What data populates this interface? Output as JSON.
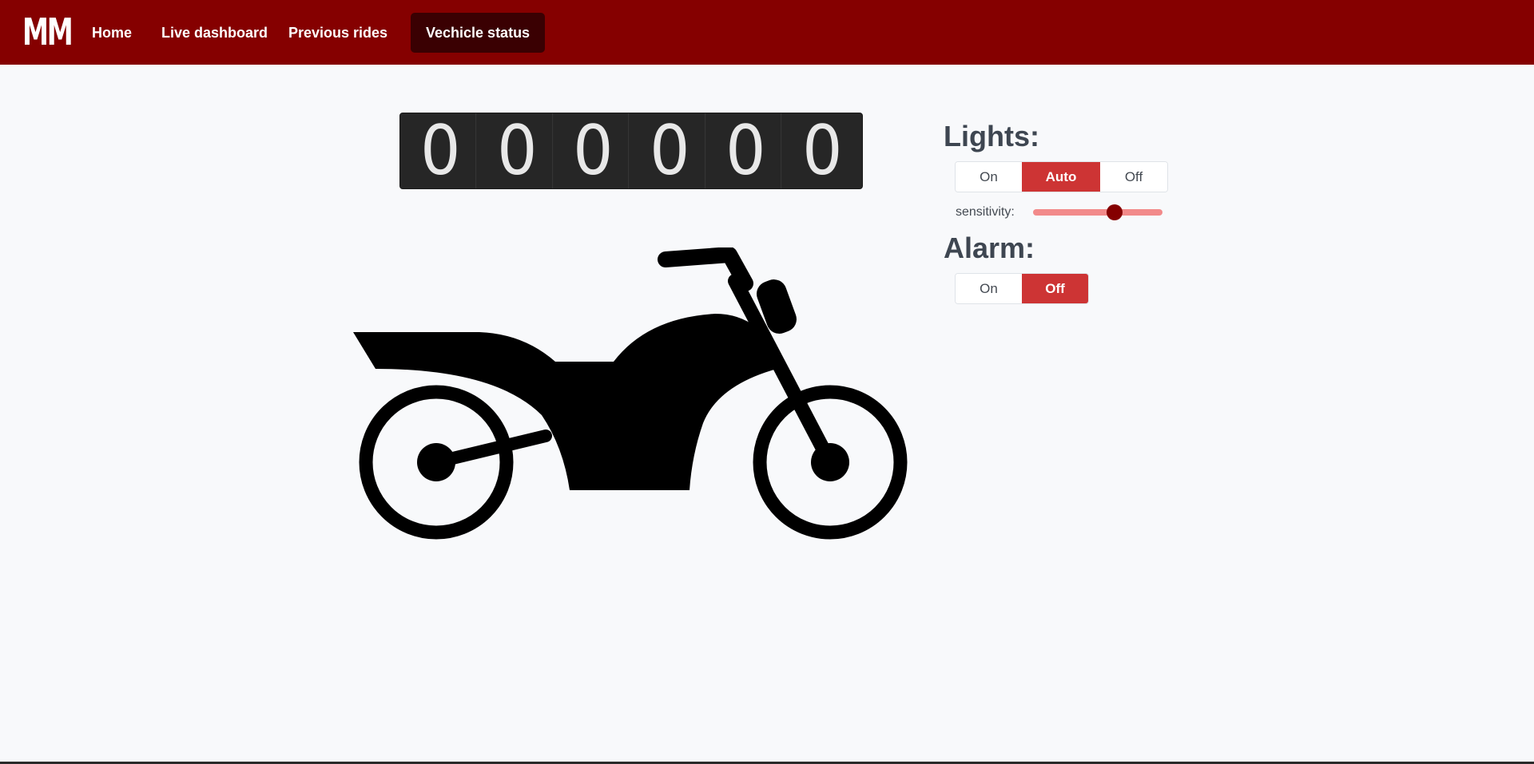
{
  "nav": {
    "logo": "MM",
    "links": [
      "Home",
      "Live dashboard",
      "Previous rides"
    ],
    "active": "Vechicle status"
  },
  "odometer": {
    "digits": [
      "0",
      "0",
      "0",
      "0",
      "0",
      "0"
    ]
  },
  "vehicle_icon": "motorcycle-icon",
  "lights": {
    "heading": "Lights:",
    "options": [
      "On",
      "Auto",
      "Off"
    ],
    "selected": "Auto",
    "sensitivity_label": "sensitivity:",
    "sensitivity_value": 0.65
  },
  "alarm": {
    "heading": "Alarm:",
    "options": [
      "On",
      "Off"
    ],
    "selected": "Off"
  },
  "colors": {
    "brand": "#850000",
    "accent": "#cd3434",
    "active_tab": "#3a0002",
    "slider_track": "#f28a8a"
  }
}
